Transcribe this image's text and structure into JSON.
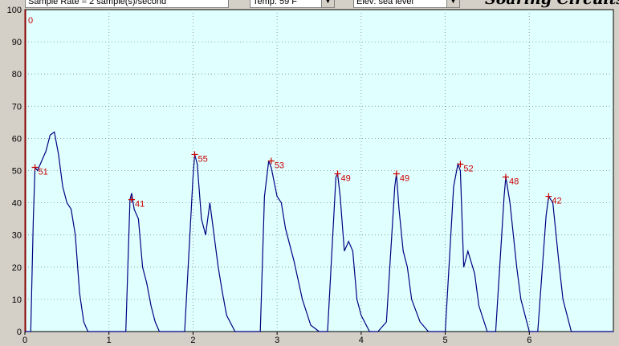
{
  "toolbar": {
    "sample_rate": "Sample Rate = 2 sample(s)/second",
    "temperature": "Temp: 59 F",
    "elevation": "Elev: sea level",
    "brand": "Soaring Circuits"
  },
  "chart_data": {
    "type": "line",
    "marker": "0",
    "xlim": [
      0,
      7
    ],
    "ylim": [
      0,
      100
    ],
    "xticks": [
      "0",
      "1",
      "2",
      "3",
      "4",
      "5",
      "6"
    ],
    "yticks": [
      "0",
      "10",
      "20",
      "30",
      "40",
      "50",
      "60",
      "70",
      "80",
      "90",
      "100"
    ],
    "grid": true,
    "colors": {
      "line": "#000080",
      "peak": "#cc0000",
      "background": "#e0ffff"
    },
    "series": [
      {
        "x": [
          0.0,
          0.07,
          0.1,
          0.12,
          0.15,
          0.2,
          0.25,
          0.3,
          0.35,
          0.4,
          0.45,
          0.5,
          0.55,
          0.6,
          0.65,
          0.7,
          0.75,
          0.8,
          0.85,
          0.9,
          1.0,
          1.1,
          1.2,
          1.25,
          1.27,
          1.3,
          1.35,
          1.4,
          1.45,
          1.5,
          1.55,
          1.6,
          1.7,
          1.8,
          1.9,
          2.0,
          2.02,
          2.05,
          2.1,
          2.15,
          2.2,
          2.25,
          2.3,
          2.35,
          2.4,
          2.5,
          2.6,
          2.7,
          2.8,
          2.85,
          2.9,
          2.93,
          3.0,
          3.05,
          3.1,
          3.2,
          3.3,
          3.4,
          3.5,
          3.6,
          3.7,
          3.72,
          3.75,
          3.8,
          3.85,
          3.9,
          3.95,
          4.0,
          4.1,
          4.2,
          4.3,
          4.4,
          4.42,
          4.45,
          4.5,
          4.55,
          4.6,
          4.7,
          4.8,
          4.9,
          5.0,
          5.1,
          5.15,
          5.18,
          5.22,
          5.27,
          5.35,
          5.4,
          5.5,
          5.6,
          5.7,
          5.72,
          5.77,
          5.85,
          5.9,
          6.0,
          6.1,
          6.2,
          6.23,
          6.28,
          6.35,
          6.4,
          6.5,
          6.6,
          6.7,
          6.8,
          7.0
        ],
        "y": [
          0,
          0,
          35,
          51,
          50,
          53,
          56,
          61,
          62,
          55,
          45,
          40,
          38,
          30,
          12,
          3,
          0,
          0,
          0,
          0,
          0,
          0,
          0,
          41,
          43,
          38,
          35,
          20,
          15,
          8,
          3,
          0,
          0,
          0,
          0,
          48,
          55,
          52,
          35,
          30,
          40,
          30,
          20,
          12,
          5,
          0,
          0,
          0,
          0,
          42,
          53,
          51,
          42,
          40,
          32,
          22,
          10,
          2,
          0,
          0,
          48,
          49,
          42,
          25,
          28,
          25,
          10,
          5,
          0,
          0,
          3,
          45,
          49,
          38,
          25,
          20,
          10,
          3,
          0,
          0,
          0,
          45,
          52,
          50,
          20,
          25,
          18,
          8,
          0,
          0,
          42,
          48,
          40,
          20,
          10,
          0,
          0,
          36,
          42,
          40,
          22,
          10,
          0,
          0,
          0,
          0,
          0
        ]
      }
    ],
    "peaks": [
      {
        "x": 0.12,
        "y": 51,
        "label": "51"
      },
      {
        "x": 1.27,
        "y": 41,
        "label": "41"
      },
      {
        "x": 2.02,
        "y": 55,
        "label": "55"
      },
      {
        "x": 2.93,
        "y": 53,
        "label": "53"
      },
      {
        "x": 3.72,
        "y": 49,
        "label": "49"
      },
      {
        "x": 4.42,
        "y": 49,
        "label": "49"
      },
      {
        "x": 5.18,
        "y": 52,
        "label": "52"
      },
      {
        "x": 5.72,
        "y": 48,
        "label": "48"
      },
      {
        "x": 6.23,
        "y": 42,
        "label": "42"
      }
    ]
  }
}
